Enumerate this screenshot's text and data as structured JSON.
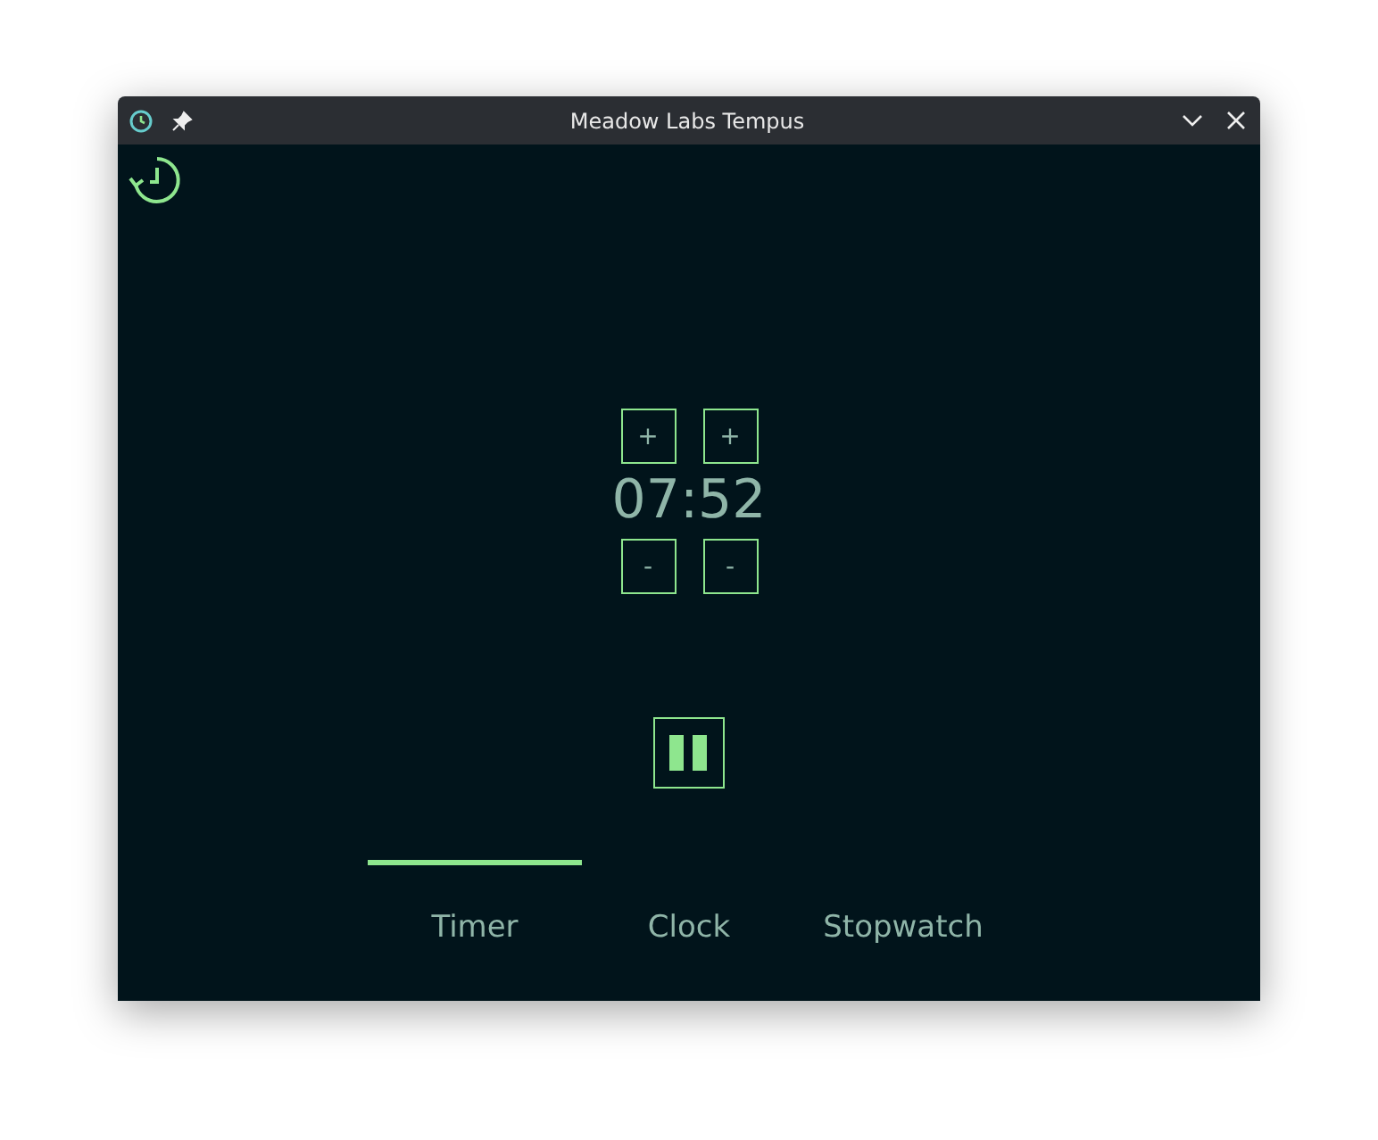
{
  "window": {
    "title": "Meadow Labs Tempus"
  },
  "timer": {
    "time": "07:52",
    "increase": [
      "+",
      "+"
    ],
    "decrease": [
      "-",
      "-"
    ],
    "running": true
  },
  "tabs": [
    {
      "label": "Timer",
      "selected": true
    },
    {
      "label": "Clock",
      "selected": false
    },
    {
      "label": "Stopwatch",
      "selected": false
    }
  ]
}
